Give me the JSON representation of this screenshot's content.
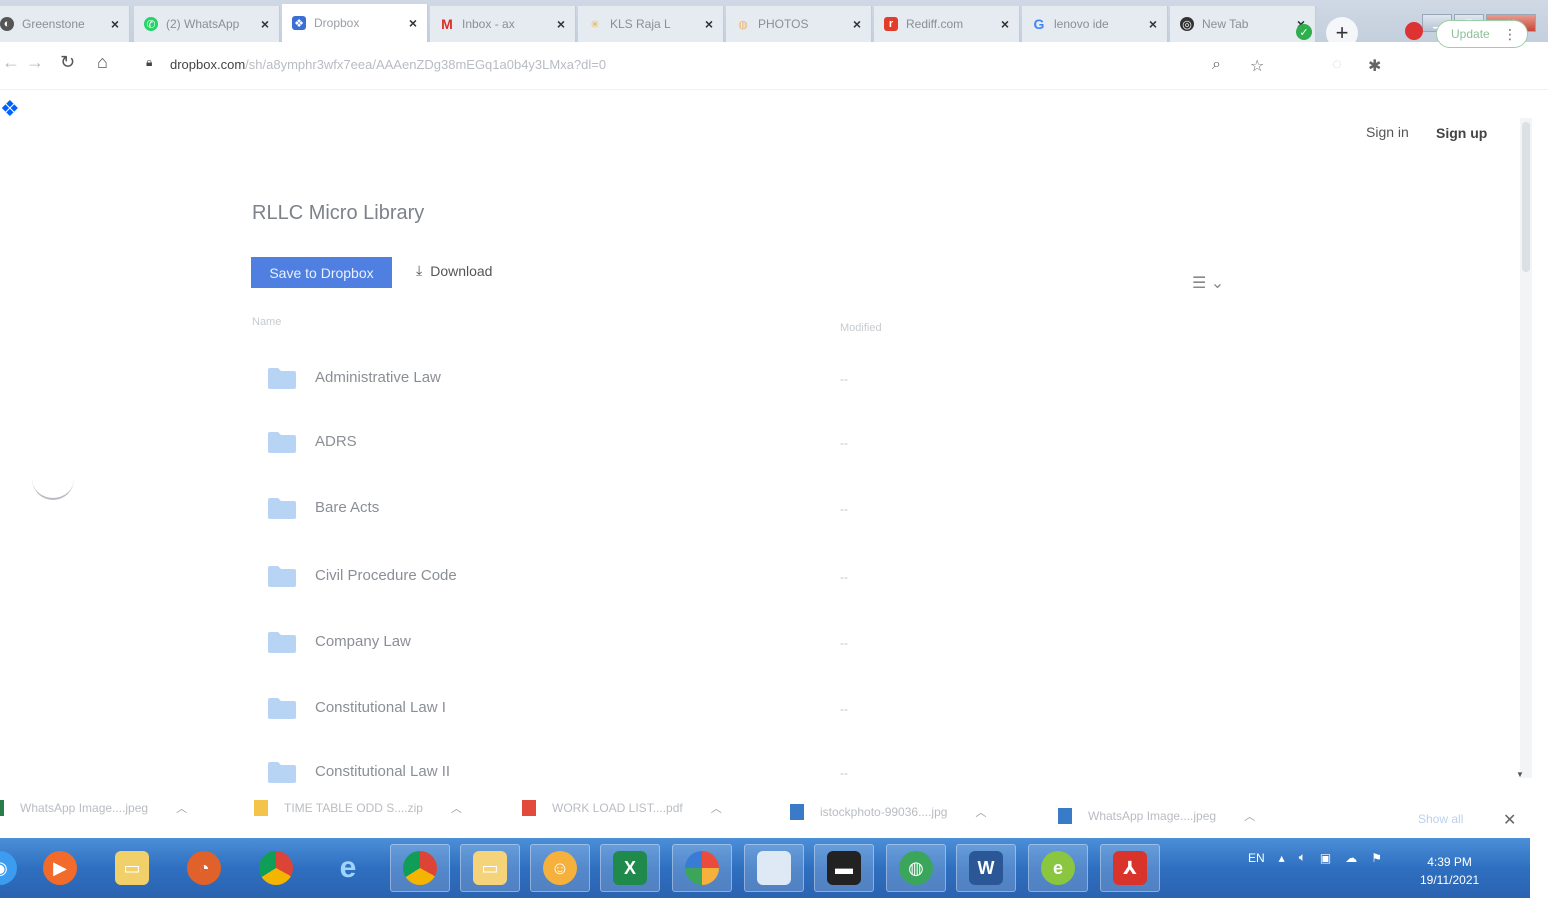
{
  "browser": {
    "tabs": [
      {
        "title": "Greenstone",
        "icon": "greenstone-icon",
        "color": "#555555"
      },
      {
        "title": "(2) WhatsApp",
        "icon": "whatsapp-icon",
        "color": "#25d366"
      },
      {
        "title": "Dropbox",
        "icon": "dropbox-icon",
        "color": "#3b6fd4",
        "active": true
      },
      {
        "title": "Inbox - ax",
        "icon": "gmail-icon",
        "color": "#d93025"
      },
      {
        "title": "KLS Raja L",
        "icon": "kls-icon",
        "color": "#f3c96b"
      },
      {
        "title": "PHOTOS",
        "icon": "photos-icon",
        "color": "#f1b46a"
      },
      {
        "title": "Rediff.com",
        "icon": "rediff-icon",
        "color": "#e23c2a"
      },
      {
        "title": "lenovo ide",
        "icon": "google-icon",
        "color": "#4285f4"
      },
      {
        "title": "New Tab",
        "icon": "globe-icon",
        "color": "#333333"
      }
    ],
    "new_tab": "+",
    "url": {
      "domain": "dropbox.com",
      "rest": "/sh/a8ymphr3wfx7eea/AAAenZDg38mEGq1a0b4y3LMxa?dl=0"
    },
    "update_label": "Update"
  },
  "header": {
    "signin": "Sign in",
    "signup": "Sign up"
  },
  "page": {
    "title": "RLLC Micro Library",
    "save_label": "Save to Dropbox",
    "download_label": "Download",
    "view_toggle": "☰ ⌄",
    "columns": {
      "name": "Name",
      "modified": "Modified"
    },
    "rows": [
      {
        "name": "Administrative Law",
        "modified": "--"
      },
      {
        "name": "ADRS",
        "modified": "--"
      },
      {
        "name": "Bare Acts",
        "modified": "--"
      },
      {
        "name": "Civil Procedure Code",
        "modified": "--"
      },
      {
        "name": "Company Law",
        "modified": "--"
      },
      {
        "name": "Constitutional Law I",
        "modified": "--"
      },
      {
        "name": "Constitutional Law II",
        "modified": "--"
      }
    ]
  },
  "downloads": {
    "items": [
      {
        "name": "WhatsApp Image....jpeg",
        "icon": "image-file-icon"
      },
      {
        "name": "TIME TABLE ODD S....zip",
        "icon": "zip-file-icon"
      },
      {
        "name": "WORK LOAD LIST....pdf",
        "icon": "pdf-file-icon"
      },
      {
        "name": "istockphoto-99036....jpg",
        "icon": "image-file-icon"
      },
      {
        "name": "WhatsApp Image....jpeg",
        "icon": "image-file-icon"
      }
    ],
    "show_all": "Show all"
  },
  "taskbar": {
    "language": "EN",
    "time": "4:39 PM",
    "date": "19/11/2021"
  },
  "colors": {
    "dropbox_blue": "#4f7fe0",
    "folder_blue": "#b7d4f4",
    "taskbar": "#2f6fc0"
  }
}
